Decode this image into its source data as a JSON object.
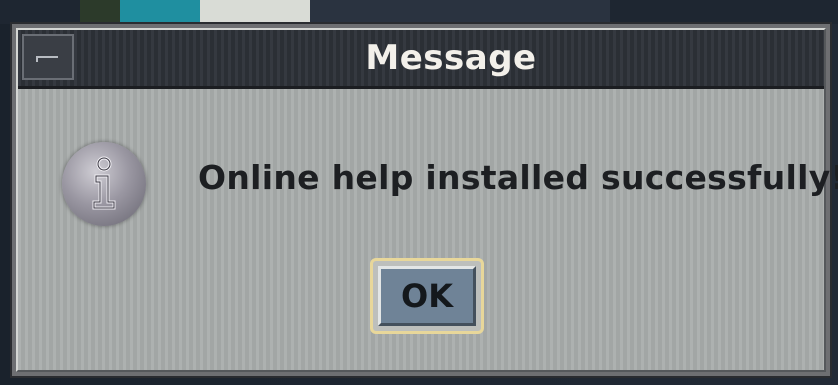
{
  "dialog": {
    "title": "Message",
    "message": "Online help installed successfully!",
    "icon": "info-icon",
    "ok_label": "OK"
  },
  "colors": {
    "title_bar": "#2d3138",
    "dialog_body": "#a9adac",
    "ok_button_face": "#6f8397",
    "ok_focus_ring": "#e8d79a"
  }
}
